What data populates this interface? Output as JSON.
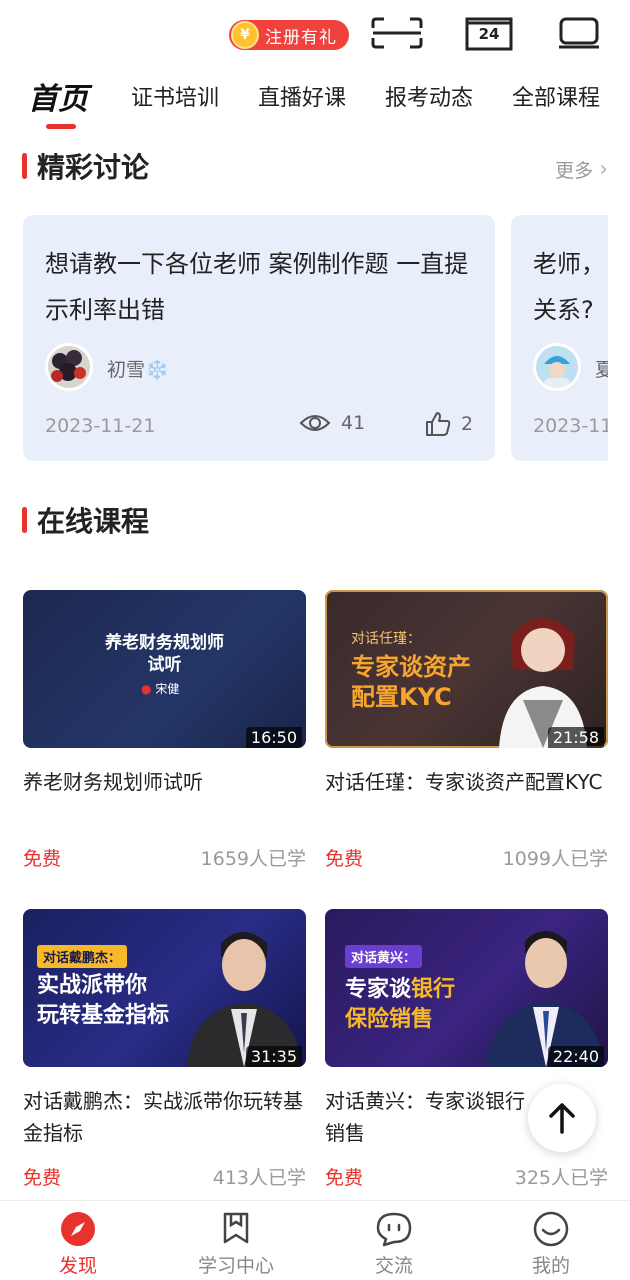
{
  "top_bar": {
    "register_badge": "注册有礼",
    "coin_symbol": "¥",
    "calendar_day": "24",
    "icons": [
      "scan-icon",
      "calendar-icon",
      "tv-icon"
    ]
  },
  "tabs": {
    "home": "首页",
    "items": [
      "证书培训",
      "直播好课",
      "报考动态",
      "全部课程"
    ]
  },
  "discussion": {
    "title": "精彩讨论",
    "more": "更多",
    "cards": [
      {
        "question": "想请教一下各位老师 案例制作题 一直提示利率出错",
        "user": "初雪❄️",
        "date": "2023-11-21",
        "views": "41",
        "likes": "2"
      },
      {
        "question": "老师，关系?",
        "user": "夏",
        "date": "2023-11"
      }
    ]
  },
  "courses": {
    "title": "在线课程",
    "items": [
      {
        "thumb_title": "养老财务规划师\n试听",
        "thumb_author": "宋健",
        "duration": "16:50",
        "title": "养老财务规划师试听",
        "price": "免费",
        "learners": "1659人已学"
      },
      {
        "thumb_tag": "对话任瑾：",
        "thumb_headline": "专家谈资产\n配置KYC",
        "duration": "21:58",
        "title": "对话任瑾：专家谈资产配置KYC",
        "price": "免费",
        "learners": "1099人已学"
      },
      {
        "thumb_tag": "对话戴鹏杰：",
        "thumb_headline": "实战派带你\n玩转基金指标",
        "duration": "31:35",
        "title": "对话戴鹏杰：实战派带你玩转基金指标",
        "price": "免费",
        "learners": "413人已学"
      },
      {
        "thumb_tag": "对话黄兴：",
        "thumb_headline_a": "专家谈",
        "thumb_headline_b": "银行",
        "thumb_headline_c": "保险销售",
        "duration": "22:40",
        "title": "对话黄兴：专家谈银行销售",
        "title_shown": "对话黄兴：专家谈银行\n销售",
        "price": "免费",
        "learners": "325人已学"
      }
    ]
  },
  "bottom_nav": [
    {
      "label": "发现",
      "icon": "compass-icon",
      "active": true
    },
    {
      "label": "学习中心",
      "icon": "bookmark-icon",
      "active": false
    },
    {
      "label": "交流",
      "icon": "chat-icon",
      "active": false
    },
    {
      "label": "我的",
      "icon": "smiley-icon",
      "active": false
    }
  ],
  "colors": {
    "accent": "#e8322e",
    "card_bg": "#e9eefb",
    "muted": "#9a9a9a"
  }
}
